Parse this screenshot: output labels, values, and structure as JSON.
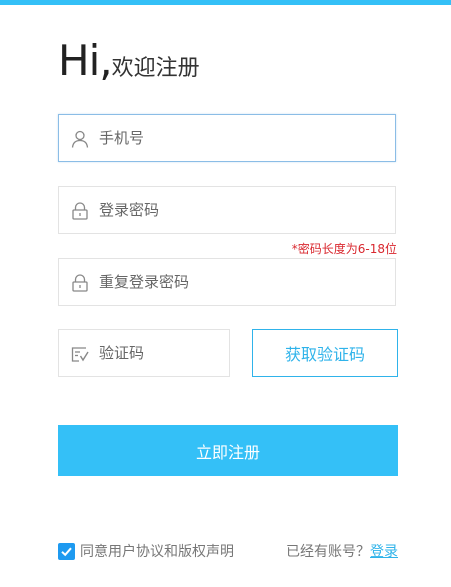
{
  "header": {
    "hi": "Hi,",
    "subtitle": "欢迎注册"
  },
  "form": {
    "phone": {
      "placeholder": "手机号",
      "icon": "user-icon"
    },
    "password": {
      "placeholder": "登录密码",
      "icon": "lock-icon"
    },
    "password_hint": "*密码长度为6-18位",
    "repeat_password": {
      "placeholder": "重复登录密码",
      "icon": "lock-icon"
    },
    "captcha": {
      "placeholder": "验证码",
      "icon": "captcha-icon"
    },
    "get_code_label": "获取验证码",
    "submit_label": "立即注册"
  },
  "footer": {
    "agree_checked": true,
    "agree_label": "同意用户协议和版权声明",
    "have_account": "已经有账号？",
    "login_link": "登录"
  },
  "colors": {
    "accent": "#34c0f7",
    "link": "#2fb3ea",
    "error": "#d9272e",
    "checkbox": "#1e9af0"
  }
}
